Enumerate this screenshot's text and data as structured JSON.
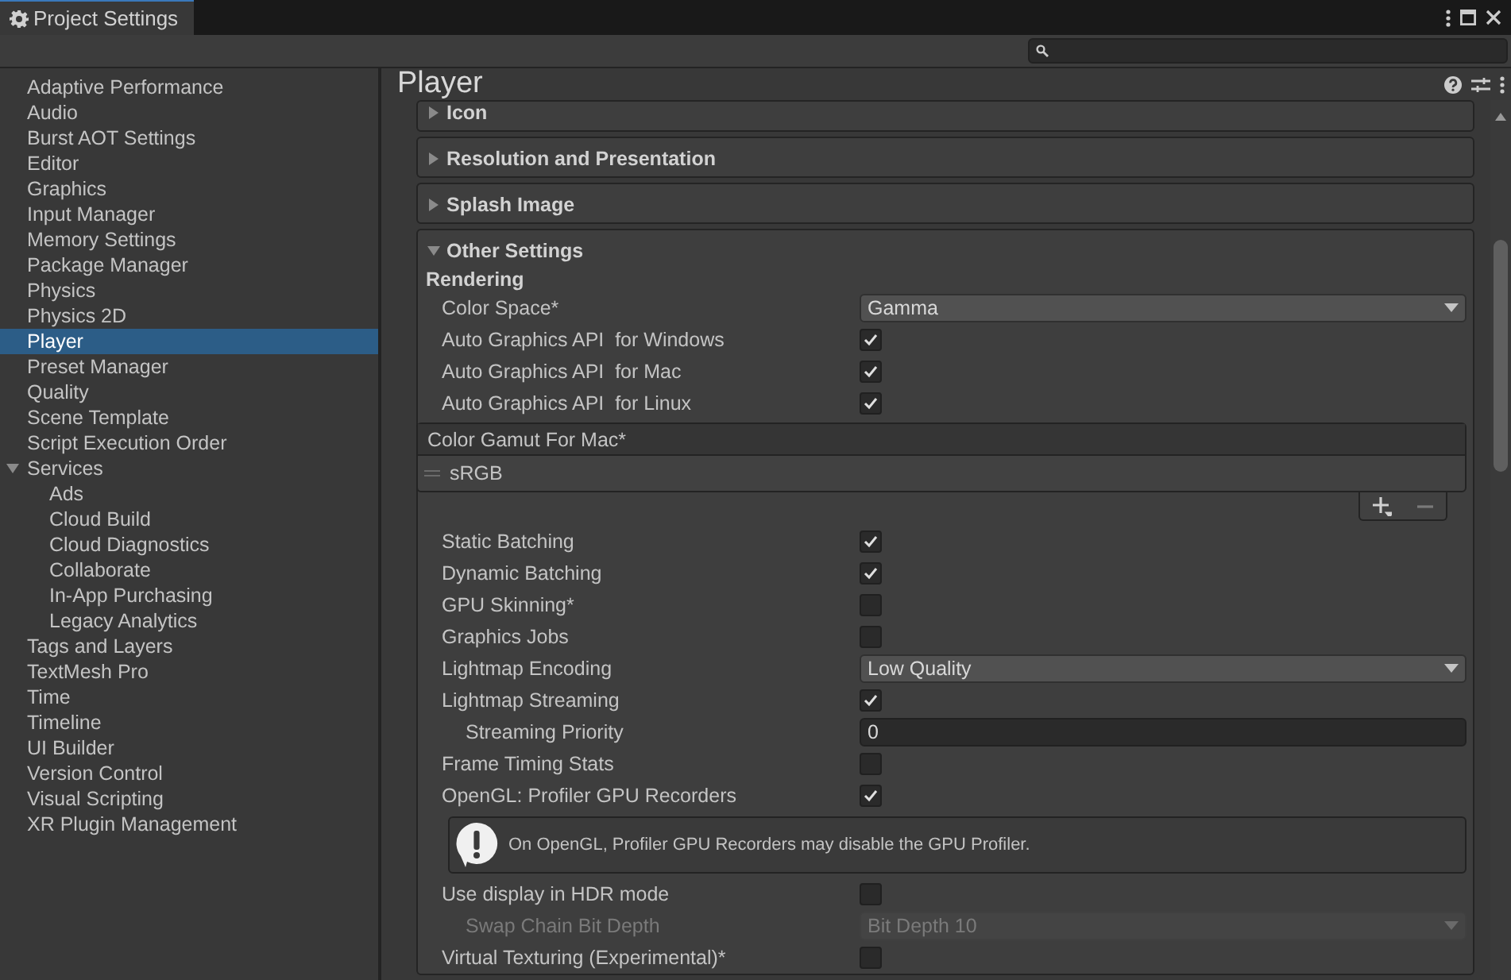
{
  "window": {
    "title": "Project Settings"
  },
  "sidebar": {
    "items": [
      {
        "label": "Adaptive Performance",
        "selected": false
      },
      {
        "label": "Audio",
        "selected": false
      },
      {
        "label": "Burst AOT Settings",
        "selected": false
      },
      {
        "label": "Editor",
        "selected": false
      },
      {
        "label": "Graphics",
        "selected": false
      },
      {
        "label": "Input Manager",
        "selected": false
      },
      {
        "label": "Memory Settings",
        "selected": false
      },
      {
        "label": "Package Manager",
        "selected": false
      },
      {
        "label": "Physics",
        "selected": false
      },
      {
        "label": "Physics 2D",
        "selected": false
      },
      {
        "label": "Player",
        "selected": true
      },
      {
        "label": "Preset Manager",
        "selected": false
      },
      {
        "label": "Quality",
        "selected": false
      },
      {
        "label": "Scene Template",
        "selected": false
      },
      {
        "label": "Script Execution Order",
        "selected": false
      },
      {
        "label": "Services",
        "selected": false,
        "expanded": true,
        "children": [
          {
            "label": "Ads",
            "selected": false
          },
          {
            "label": "Cloud Build",
            "selected": false
          },
          {
            "label": "Cloud Diagnostics",
            "selected": false
          },
          {
            "label": "Collaborate",
            "selected": false
          },
          {
            "label": "In-App Purchasing",
            "selected": false
          },
          {
            "label": "Legacy Analytics",
            "selected": false
          }
        ]
      },
      {
        "label": "Tags and Layers",
        "selected": false
      },
      {
        "label": "TextMesh Pro",
        "selected": false
      },
      {
        "label": "Time",
        "selected": false
      },
      {
        "label": "Timeline",
        "selected": false
      },
      {
        "label": "UI Builder",
        "selected": false
      },
      {
        "label": "Version Control",
        "selected": false
      },
      {
        "label": "Visual Scripting",
        "selected": false
      },
      {
        "label": "XR Plugin Management",
        "selected": false
      }
    ]
  },
  "page": {
    "title": "Player",
    "sections": [
      {
        "title": "Icon",
        "expanded": false
      },
      {
        "title": "Resolution and Presentation",
        "expanded": false
      },
      {
        "title": "Splash Image",
        "expanded": false
      },
      {
        "title": "Other Settings",
        "expanded": true,
        "group": "Rendering",
        "rows": [
          {
            "kind": "dropdown",
            "label": "Color Space*",
            "value": "Gamma",
            "disabled": false
          },
          {
            "kind": "checkbox",
            "label": "Auto Graphics API  for Windows",
            "checked": true
          },
          {
            "kind": "checkbox",
            "label": "Auto Graphics API  for Mac",
            "checked": true
          },
          {
            "kind": "checkbox",
            "label": "Auto Graphics API  for Linux",
            "checked": true
          },
          {
            "kind": "list",
            "label": "Color Gamut For Mac*",
            "items": [
              "sRGB"
            ]
          },
          {
            "kind": "checkbox",
            "label": "Static Batching",
            "checked": true
          },
          {
            "kind": "checkbox",
            "label": "Dynamic Batching",
            "checked": true
          },
          {
            "kind": "checkbox",
            "label": "GPU Skinning*",
            "checked": false
          },
          {
            "kind": "checkbox",
            "label": "Graphics Jobs",
            "checked": false
          },
          {
            "kind": "dropdown",
            "label": "Lightmap Encoding",
            "value": "Low Quality",
            "disabled": false
          },
          {
            "kind": "checkbox",
            "label": "Lightmap Streaming",
            "checked": true,
            "children": [
              {
                "kind": "number",
                "label": "Streaming Priority",
                "value": "0"
              }
            ]
          },
          {
            "kind": "checkbox",
            "label": "Frame Timing Stats",
            "checked": false
          },
          {
            "kind": "checkbox",
            "label": "OpenGL: Profiler GPU Recorders",
            "checked": true
          },
          {
            "kind": "help",
            "label": "On OpenGL, Profiler GPU Recorders may disable the GPU Profiler."
          },
          {
            "kind": "checkbox",
            "label": "Use display in HDR mode",
            "checked": false,
            "children": [
              {
                "kind": "dropdown",
                "label": "Swap Chain Bit Depth",
                "value": "Bit Depth 10",
                "disabled": true
              }
            ]
          },
          {
            "kind": "checkbox",
            "label": "Virtual Texturing (Experimental)*",
            "checked": false
          }
        ]
      }
    ]
  }
}
